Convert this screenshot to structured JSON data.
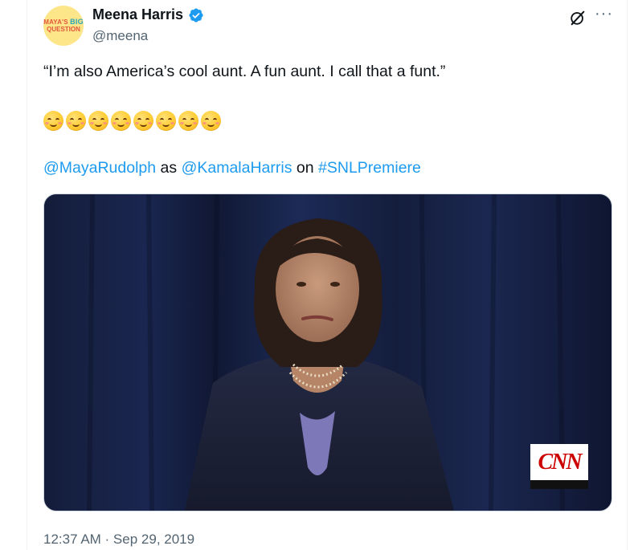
{
  "author": {
    "display_name": "Meena Harris",
    "handle": "@meena",
    "avatar_text_1": "MAYA'S",
    "avatar_text_big": "BIG",
    "avatar_text_2": "QUESTION"
  },
  "icons": {
    "verified": "verified-badge-icon",
    "grok": "grok-icon",
    "more": "more-icon"
  },
  "colors": {
    "link": "#1d9bf0",
    "verified": "#1d9bf0",
    "text": "#0f1419",
    "secondary": "#536471"
  },
  "tweet": {
    "line1": "“I’m also America’s cool aunt. A fun aunt. I call that a funt.”",
    "emoji": [
      "😊",
      "😊",
      "😊",
      "😊",
      "😊",
      "😊",
      "😊",
      "😊"
    ],
    "mention1": "@MayaRudolph",
    "word_as": " as ",
    "mention2": "@KamalaHarris",
    "word_on": " on ",
    "hashtag": "#SNLPremiere"
  },
  "media": {
    "watermark": "CNN"
  },
  "timestamp": "12:37 AM · Sep 29, 2019",
  "more_label": "···"
}
